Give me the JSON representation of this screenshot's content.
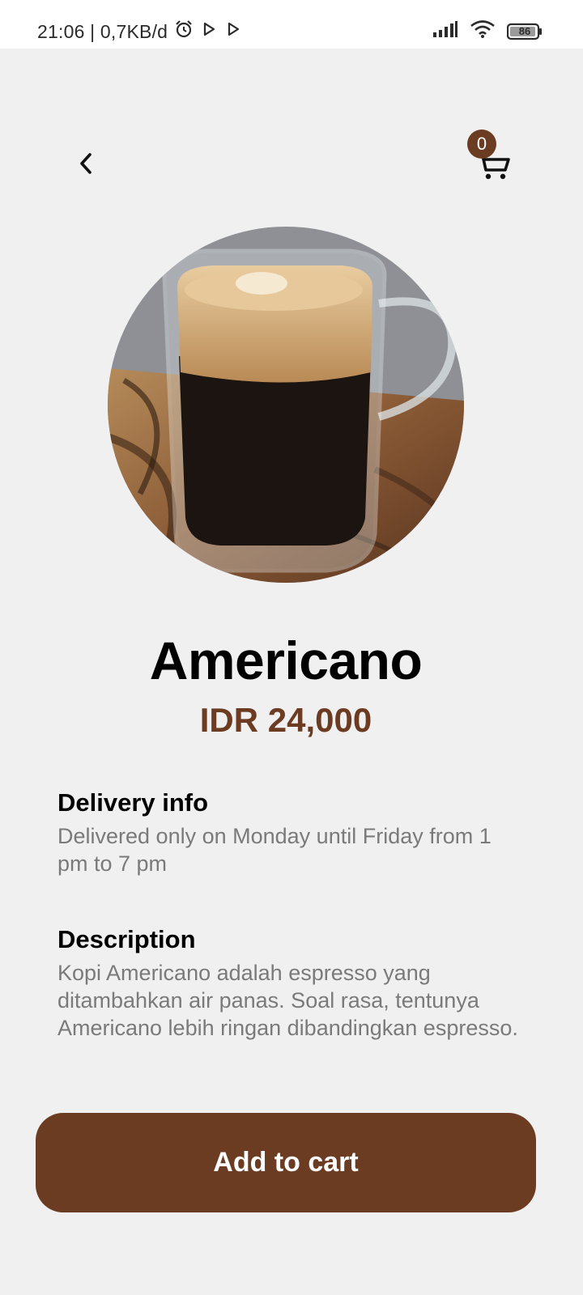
{
  "status_bar": {
    "time_speed": "21:06 | 0,7KB/d",
    "battery": "86",
    "icons": [
      "alarm-icon",
      "play-icon",
      "play-icon",
      "signal-icon",
      "wifi-icon",
      "battery-icon"
    ]
  },
  "header": {
    "back_icon": "chevron-left-icon",
    "cart_icon": "cart-icon",
    "cart_count": "0"
  },
  "product": {
    "name": "Americano",
    "price": "IDR 24,000",
    "image": "coffee-cup-photo"
  },
  "delivery": {
    "title": "Delivery info",
    "text": "Delivered only on Monday until Friday from 1 pm to 7 pm"
  },
  "description": {
    "title": "Description",
    "text": "Kopi Americano adalah espresso yang ditambahkan air panas. Soal rasa, tentunya Americano lebih ringan dibandingkan espresso."
  },
  "actions": {
    "add_to_cart": "Add to cart"
  },
  "colors": {
    "accent": "#6b3b22",
    "background": "#f1f0f1",
    "muted_text": "#7a7a7a"
  }
}
